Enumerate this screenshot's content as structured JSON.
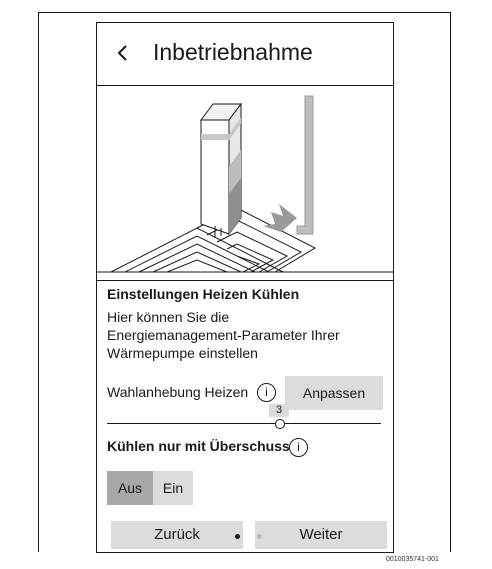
{
  "screen": {
    "title": "Inbetriebnahme",
    "back_icon": "chevron-left-icon"
  },
  "section": {
    "title": "Einstellungen Heizen Kühlen",
    "description_lines": [
      "Hier können Sie die",
      "Energiemanagement-Parameter Ihrer",
      "Wärmepumpe einstellen"
    ]
  },
  "heating_boost": {
    "label": "Wahlanhebung Heizen",
    "info_symbol": "i",
    "adjust_button": "Anpassen",
    "slider_value": "3"
  },
  "cooling": {
    "label": "Kühlen nur mit Überschuss",
    "info_symbol": "i",
    "options": [
      "Aus",
      "Ein"
    ],
    "selected": "Aus"
  },
  "navigation": {
    "back_button": "Zurück",
    "next_button": "Weiter",
    "page_count": 2,
    "current_page": 1
  },
  "figure_id": "0010035741-001",
  "colors": {
    "button_bg": "#dcdcdc",
    "selected_bg": "#a8a8a8",
    "line": "#1a1a1a"
  }
}
